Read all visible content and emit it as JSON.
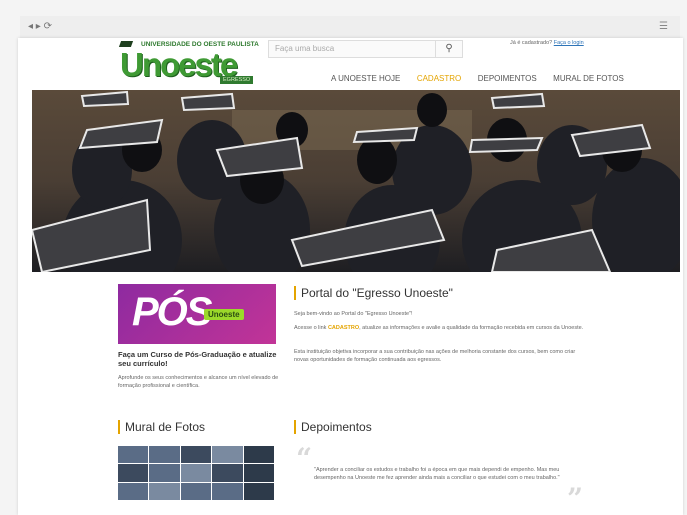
{
  "site": {
    "university_line": "UNIVERSIDADE DO OESTE PAULISTA",
    "brand": "Unoeste",
    "tagline": "EGRESSO"
  },
  "search": {
    "placeholder": "Faça uma busca",
    "button_icon": "search-icon"
  },
  "login": {
    "prompt": "Já é cadastrado?",
    "link": "Faça o login"
  },
  "menu": [
    {
      "label": "A UNOESTE HOJE",
      "active": false
    },
    {
      "label": "CADASTRO",
      "active": true
    },
    {
      "label": "DEPOIMENTOS",
      "active": false
    },
    {
      "label": "MURAL DE FOTOS",
      "active": false
    }
  ],
  "promo": {
    "big": "PÓS",
    "small": "Unoeste",
    "title": "Faça um Curso de Pós-Graduação e atualize seu currículo!",
    "desc": "Aprofunde os seus conhecimentos e alcance um nível elevado de formação profissional e científica."
  },
  "portal": {
    "title": "Portal do \"Egresso Unoeste\"",
    "p1": "Seja bem-vindo ao Portal do \"Egresso Unoeste\"!",
    "p2_a": "Acesse o link ",
    "p2_link": "CADASTRO",
    "p2_b": ", atualize as informações e avalie a qualidade da formação recebida em cursos da Unoeste.",
    "p3": "Esta instituição objetiva incorporar a sua contribuição nas ações de melhoria constante dos cursos, bem como criar novas oportunidades de formação continuada aos egressos."
  },
  "mural": {
    "title": "Mural de Fotos"
  },
  "depoimentos": {
    "title": "Depoimentos",
    "quote": "\"Aprender a conciliar os estudos e trabalho foi a época em que mais dependi de empenho. Mas meu desempenho na Unoeste me fez aprender ainda mais a conciliar o que estudei com o meu trabalho.\""
  },
  "colors": {
    "accent": "#e4a400",
    "brand_green": "#3f9a34",
    "promo_purple": "#8e2aa0"
  }
}
